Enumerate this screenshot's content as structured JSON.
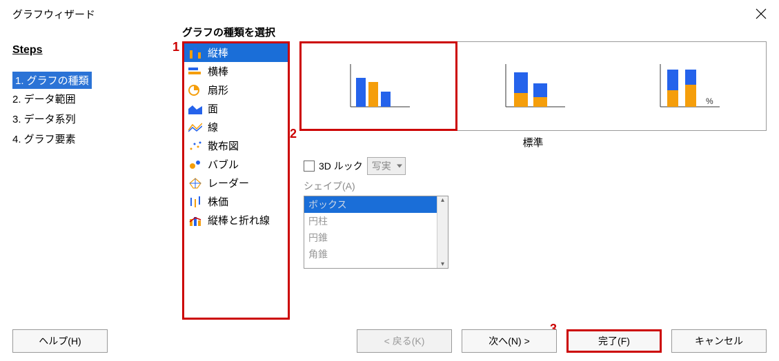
{
  "title": "グラフウィザード",
  "steps_header": "Steps",
  "steps": [
    "1. グラフの種類",
    "2. データ範囲",
    "3. データ系列",
    "4. グラフ要素"
  ],
  "section_header": "グラフの種類を選択",
  "chart_types": [
    "縦棒",
    "横棒",
    "扇形",
    "面",
    "線",
    "散布図",
    "バブル",
    "レーダー",
    "株価",
    "縦棒と折れ線"
  ],
  "subtype_label": "標準",
  "look3d_label": "3D ルック",
  "look3d_select": "写実",
  "shape_label": "シェイプ(A)",
  "shapes": [
    "ボックス",
    "円柱",
    "円錐",
    "角錐"
  ],
  "buttons": {
    "help": "ヘルプ(H)",
    "back": "< 戻る(K)",
    "next": "次へ(N) >",
    "finish": "完了(F)",
    "cancel": "キャンセル"
  },
  "annotations": {
    "a1": "1",
    "a2": "2",
    "a3": "3"
  }
}
